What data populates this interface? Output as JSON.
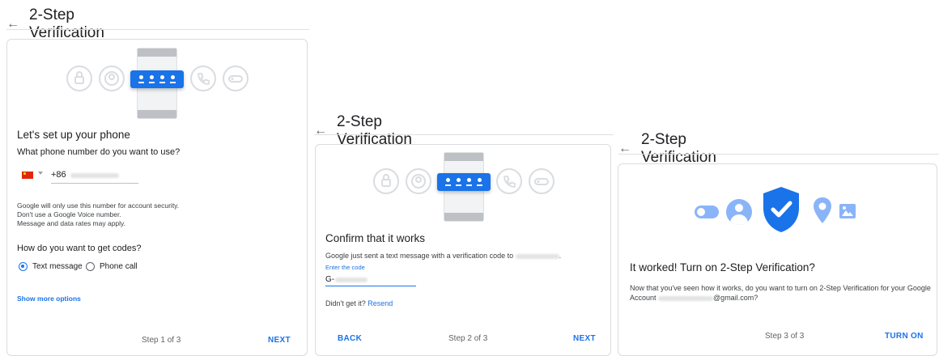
{
  "screen1": {
    "header_title": "2-Step Verification",
    "back_arrow": "←",
    "card_title": "Let's set up your phone",
    "question": "What phone number do you want to use?",
    "country_code": "+86",
    "disclaimer": [
      "Google will only use this number for account security.",
      "Don't use a Google Voice number.",
      "Message and data rates may apply."
    ],
    "codes_question": "How do you want to get codes?",
    "option_text": "Text message",
    "option_call": "Phone call",
    "selected_option": "Text message",
    "show_more": "Show more options",
    "step": "Step 1 of 3",
    "next": "NEXT"
  },
  "screen2": {
    "header_title": "2-Step Verification",
    "back_arrow": "←",
    "card_title": "Confirm that it works",
    "message": "Google just sent a text message with a verification code to",
    "message_end": ".",
    "input_label": "Enter the code",
    "code_prefix": "G-",
    "didnt_get": "Didn't get it?",
    "resend": "Resend",
    "back": "BACK",
    "step": "Step 2 of 3",
    "next": "NEXT"
  },
  "screen3": {
    "header_title": "2-Step Verification",
    "back_arrow": "←",
    "card_title": "It worked! Turn on 2-Step Verification?",
    "message": "Now that you've seen how it works, do you want to turn on 2-Step Verification for your Google",
    "account_word": "Account",
    "email_suffix": "@gmail.com?",
    "step": "Step 3 of 3",
    "turn_on": "TURN ON"
  },
  "colors": {
    "accent": "#1a73e8",
    "icon_gray": "#dadce0",
    "shield_blue": "#1a73e8",
    "light_blue": "#8ab4f8"
  },
  "icons": [
    "arrow-back-icon",
    "lock-icon",
    "account-icon",
    "password-icon",
    "phone-icon",
    "key-icon",
    "china-flag-icon",
    "dropdown-icon",
    "toggle-icon",
    "shield-check-icon",
    "location-icon",
    "image-icon"
  ]
}
